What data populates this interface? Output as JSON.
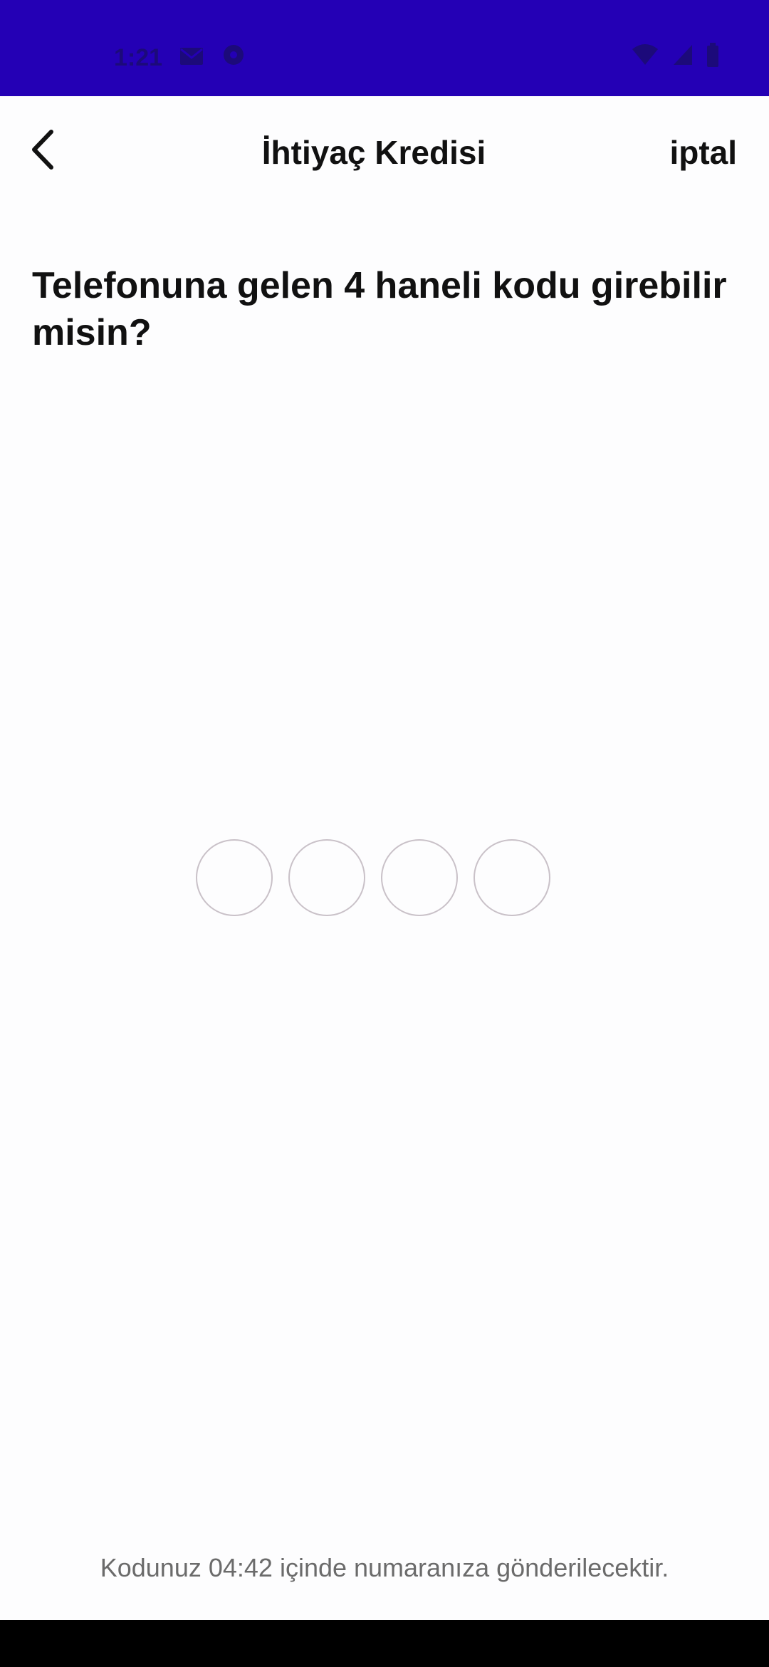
{
  "status_bar": {
    "time": "1:21",
    "background": "#2400b5",
    "icons_left": [
      "gmail-icon",
      "notification-icon"
    ],
    "icons_right": [
      "wifi-icon",
      "signal-icon",
      "battery-icon"
    ]
  },
  "header": {
    "title": "İhtiyaç Kredisi",
    "cancel_label": "iptal",
    "back_icon": "chevron-left-icon"
  },
  "question": {
    "text": "Telefonuna gelen 4 haneli kodu girebilir misin?"
  },
  "otp": {
    "digits": [
      "",
      "",
      "",
      ""
    ],
    "length": 4
  },
  "footer": {
    "timer_text": "Kodunuz 04:42 içinde numaranıza gönderilecektir."
  }
}
